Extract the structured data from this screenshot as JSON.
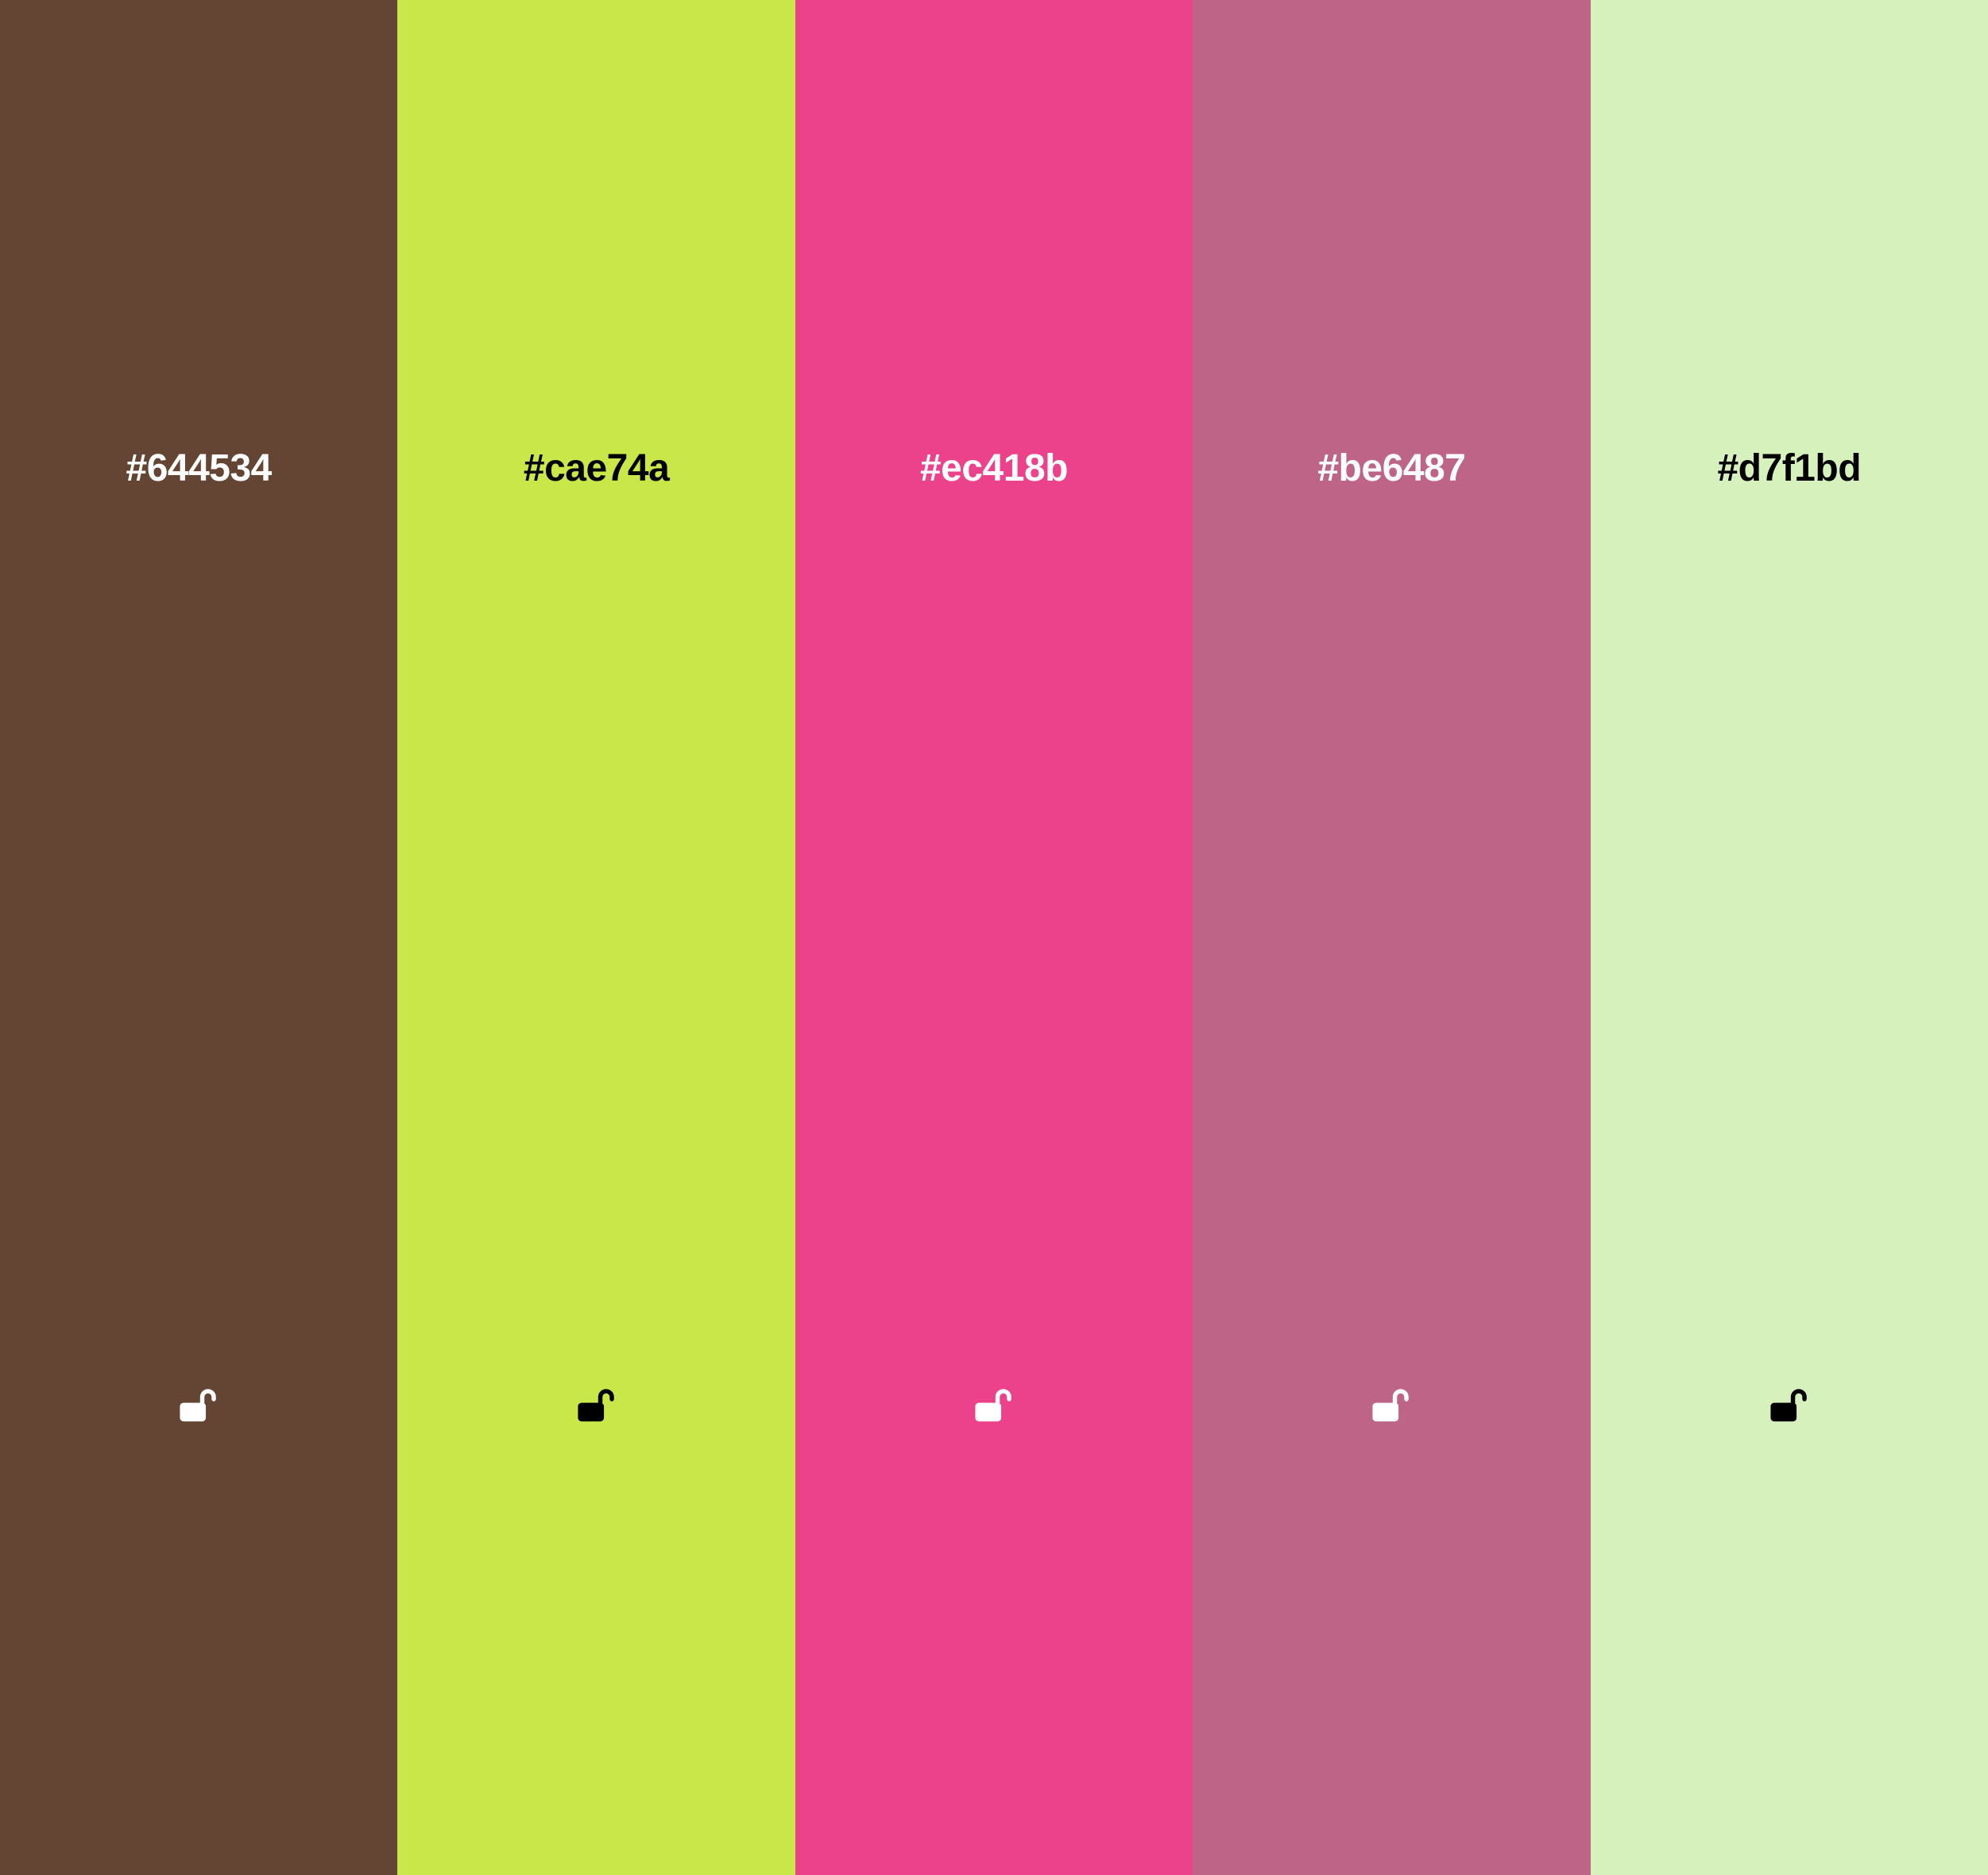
{
  "palette": {
    "swatches": [
      {
        "hex": "#644534",
        "background": "#644534",
        "text_color": "#ffffff",
        "lock_state": "unlocked",
        "icon": "unlocked-padlock-icon"
      },
      {
        "hex": "#cae74a",
        "background": "#cae74a",
        "text_color": "#000000",
        "lock_state": "unlocked",
        "icon": "unlocked-padlock-icon"
      },
      {
        "hex": "#ec418b",
        "background": "#ec418b",
        "text_color": "#ffffff",
        "lock_state": "unlocked",
        "icon": "unlocked-padlock-icon"
      },
      {
        "hex": "#be6487",
        "background": "#be6487",
        "text_color": "#ffffff",
        "lock_state": "unlocked",
        "icon": "unlocked-padlock-icon"
      },
      {
        "hex": "#d7f1bd",
        "background": "#d7f1bd",
        "text_color": "#000000",
        "lock_state": "unlocked",
        "icon": "unlocked-padlock-icon"
      }
    ]
  }
}
